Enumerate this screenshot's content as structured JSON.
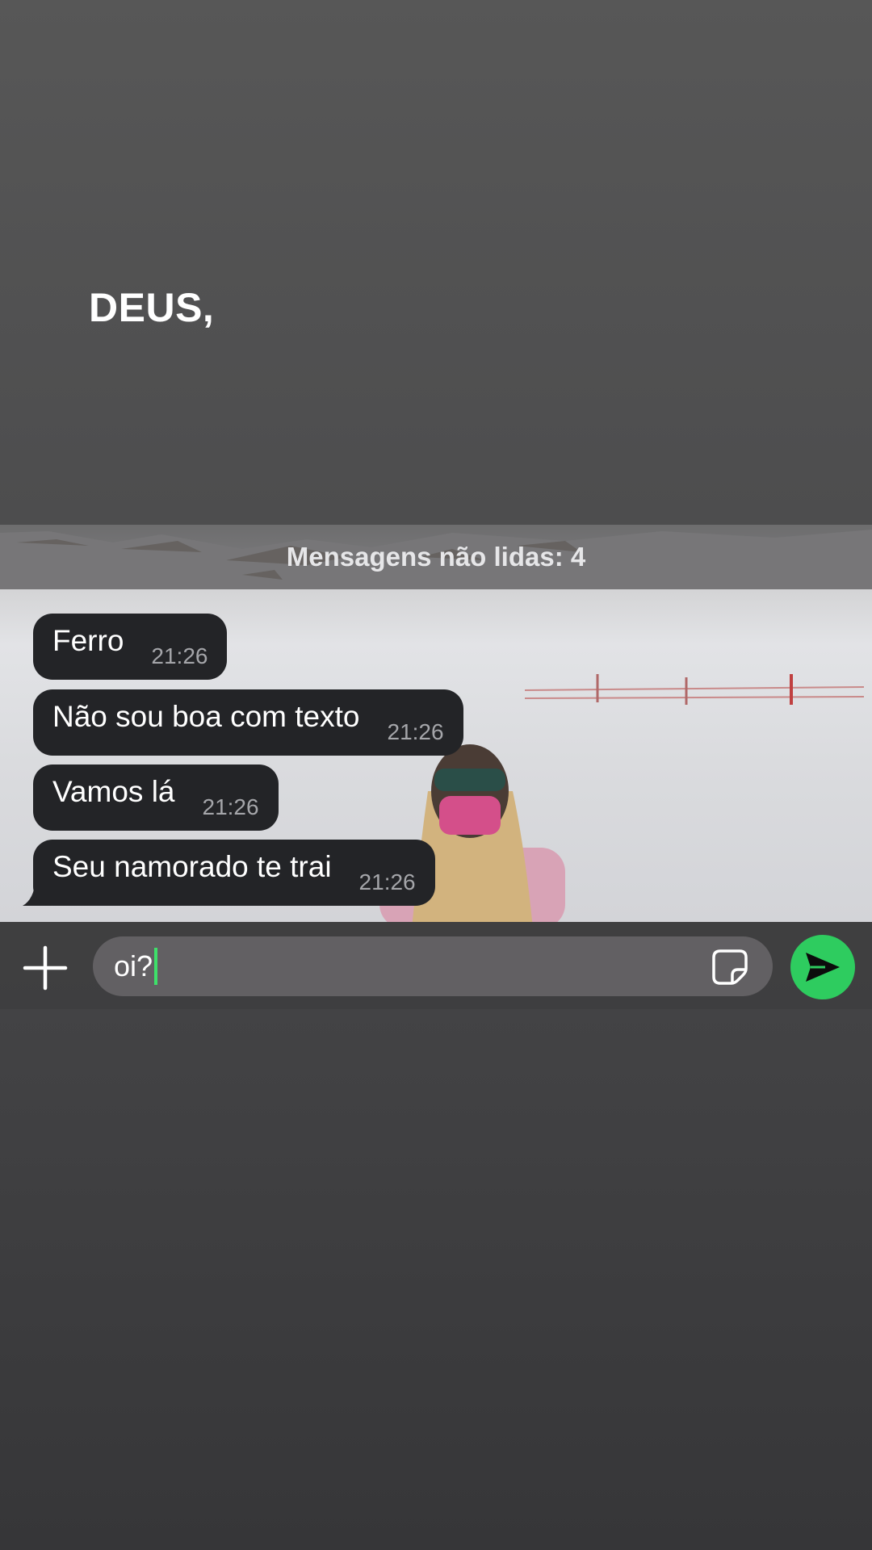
{
  "caption": "DEUS,",
  "unread": {
    "label": "Mensagens não lidas: 4"
  },
  "messages": [
    {
      "text": "Ferro",
      "time": "21:26"
    },
    {
      "text": "Não sou boa com texto",
      "time": "21:26"
    },
    {
      "text": "Vamos lá",
      "time": "21:26"
    },
    {
      "text": "Seu namorado te trai",
      "time": "21:26"
    }
  ],
  "composer": {
    "value": "oi?"
  },
  "icons": {
    "plus": "plus-icon",
    "sticker": "sticker-icon",
    "send": "send-icon"
  },
  "colors": {
    "bubble": "#232427",
    "send_button": "#2ecc5f",
    "caret": "#3ee06a"
  }
}
